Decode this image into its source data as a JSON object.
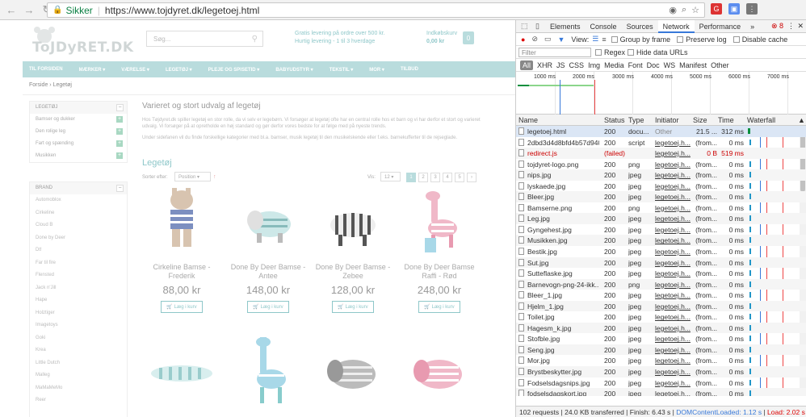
{
  "browser": {
    "secure_label": "Sikker",
    "url": "https://www.tojdyret.dk/legetoej.html"
  },
  "site": {
    "logo_text": "ToJDyRET.DK",
    "search_placeholder": "Søg...",
    "shipping_line1": "Gratis levering på ordre over 500 kr.",
    "shipping_line2": "Hurtig levering - 1 til 3 hverdage",
    "cart_label": "Indkøbskurv",
    "cart_amount": "0,00 kr",
    "cart_count": "0",
    "menu": [
      "TIL FORSIDEN",
      "MÆRKER ▾",
      "VÆRELSE ▾",
      "LEGETØJ ▾",
      "PLEJE OG SPISETID ▾",
      "BABYUDSTYR ▾",
      "TEKSTIL ▾",
      "MOR ▾",
      "TILBUD"
    ],
    "breadcrumb_home": "Forside",
    "breadcrumb_current": "Legetøj",
    "sidebar_legetoej_title": "LEGETØJ",
    "sidebar_legetoej": [
      "Bamser og dukker",
      "Den rolige leg",
      "Fart og spænding",
      "Musikken"
    ],
    "sidebar_brand_title": "BRAND",
    "brands": [
      "Automoblox",
      "Cirkeline",
      "Cloud B",
      "Done by Deer",
      "Dt!",
      "Far til fire",
      "Flensted",
      "Jack n'Jill",
      "Hape",
      "Holztiger",
      "Imagetoys",
      "Goki",
      "Krea",
      "Little Dutch",
      "Malleg",
      "MaMaMeMo",
      "Reer"
    ],
    "main_title": "Varieret og stort udvalg af legetøj",
    "intro1": "Hos Tøjdyret.dk spiller legetøj en stor rolle, da vi selv er legebørn. Vi forsøger at legetøj ofte har en central rolle hos et barn og vi har derfor et stort og varieret udvalg. Vi forsøger på at opretholde en høj standard og gør derfor vores bedste for at følge med på nyeste trends.",
    "intro2": "Under sidefanen vil du finde forskellige kategorier med bl.a. bamser, musik legetøj til den musikelskende eller f.eks. barnekufferter til de rejseglade.",
    "category_title": "Legetøj",
    "sort_label": "Sorter efter:",
    "sort_value": "Position",
    "vis_label": "Vis:",
    "vis_value": "12",
    "pages": [
      "1",
      "2",
      "3",
      "4",
      "5",
      "›"
    ],
    "add_to_cart": "Læg i kurv",
    "products": [
      {
        "name": "Cirkeline Bamse - Frederik",
        "price": "88,00 kr"
      },
      {
        "name": "Done By Deer Bamse - Antee",
        "price": "148,00 kr"
      },
      {
        "name": "Done By Deer Bamse - Zebee",
        "price": "128,00 kr"
      },
      {
        "name": "Done By Deer Bamse Raffi - Rød",
        "price": "248,00 kr"
      }
    ]
  },
  "devtools": {
    "tabs": [
      "Elements",
      "Console",
      "Sources",
      "Network",
      "Performance",
      "»"
    ],
    "error_count": "8",
    "view_label": "View:",
    "group_by_frame": "Group by frame",
    "preserve_log": "Preserve log",
    "disable_cache": "Disable cache",
    "filter_placeholder": "Filter",
    "regex": "Regex",
    "hide_data_urls": "Hide data URLs",
    "types": [
      "All",
      "XHR",
      "JS",
      "CSS",
      "Img",
      "Media",
      "Font",
      "Doc",
      "WS",
      "Manifest",
      "Other"
    ],
    "timeline_ticks": [
      "1000 ms",
      "2000 ms",
      "3000 ms",
      "4000 ms",
      "5000 ms",
      "6000 ms",
      "7000 ms"
    ],
    "columns": {
      "name": "Name",
      "status": "Status",
      "type": "Type",
      "initiator": "Initiator",
      "size": "Size",
      "time": "Time",
      "waterfall": "Waterfall"
    },
    "requests": [
      {
        "name": "legetoej.html",
        "status": "200",
        "type": "docu...",
        "initiator": "Other",
        "size": "21.5 ...",
        "time": "312 ms"
      },
      {
        "name": "2dbd3d4d8bfd4b57d940...",
        "status": "200",
        "type": "script",
        "initiator": "legetoej.h...",
        "size": "(from...",
        "time": "0 ms"
      },
      {
        "name": "redirect.js",
        "status": "(failed)",
        "type": "",
        "initiator": "legetoej.h...",
        "size": "0 B",
        "time": "519 ms"
      },
      {
        "name": "tojdyret-logo.png",
        "status": "200",
        "type": "png",
        "initiator": "legetoej.h...",
        "size": "(from...",
        "time": "0 ms"
      },
      {
        "name": "nips.jpg",
        "status": "200",
        "type": "jpeg",
        "initiator": "legetoej.h...",
        "size": "(from...",
        "time": "0 ms"
      },
      {
        "name": "lyskaede.jpg",
        "status": "200",
        "type": "jpeg",
        "initiator": "legetoej.h...",
        "size": "(from...",
        "time": "0 ms"
      },
      {
        "name": "Bleer.jpg",
        "status": "200",
        "type": "jpeg",
        "initiator": "legetoej.h...",
        "size": "(from...",
        "time": "0 ms"
      },
      {
        "name": "Bamserne.png",
        "status": "200",
        "type": "png",
        "initiator": "legetoej.h...",
        "size": "(from...",
        "time": "0 ms"
      },
      {
        "name": "Leg.jpg",
        "status": "200",
        "type": "jpeg",
        "initiator": "legetoej.h...",
        "size": "(from...",
        "time": "0 ms"
      },
      {
        "name": "Gyngehest.jpg",
        "status": "200",
        "type": "jpeg",
        "initiator": "legetoej.h...",
        "size": "(from...",
        "time": "0 ms"
      },
      {
        "name": "Musikken.jpg",
        "status": "200",
        "type": "jpeg",
        "initiator": "legetoej.h...",
        "size": "(from...",
        "time": "0 ms"
      },
      {
        "name": "Bestik.jpg",
        "status": "200",
        "type": "jpeg",
        "initiator": "legetoej.h...",
        "size": "(from...",
        "time": "0 ms"
      },
      {
        "name": "Sut.jpg",
        "status": "200",
        "type": "jpeg",
        "initiator": "legetoej.h...",
        "size": "(from...",
        "time": "0 ms"
      },
      {
        "name": "Sutteflaske.jpg",
        "status": "200",
        "type": "jpeg",
        "initiator": "legetoej.h...",
        "size": "(from...",
        "time": "0 ms"
      },
      {
        "name": "Barnevogn-png-24-ikk...",
        "status": "200",
        "type": "png",
        "initiator": "legetoej.h...",
        "size": "(from...",
        "time": "0 ms"
      },
      {
        "name": "Bleer_1.jpg",
        "status": "200",
        "type": "jpeg",
        "initiator": "legetoej.h...",
        "size": "(from...",
        "time": "0 ms"
      },
      {
        "name": "Hjelm_1.jpg",
        "status": "200",
        "type": "jpeg",
        "initiator": "legetoej.h...",
        "size": "(from...",
        "time": "0 ms"
      },
      {
        "name": "Toilet.jpg",
        "status": "200",
        "type": "jpeg",
        "initiator": "legetoej.h...",
        "size": "(from...",
        "time": "0 ms"
      },
      {
        "name": "Hagesm_k.jpg",
        "status": "200",
        "type": "jpeg",
        "initiator": "legetoej.h...",
        "size": "(from...",
        "time": "0 ms"
      },
      {
        "name": "Stofble.jpg",
        "status": "200",
        "type": "jpeg",
        "initiator": "legetoej.h...",
        "size": "(from...",
        "time": "0 ms"
      },
      {
        "name": "Seng.jpg",
        "status": "200",
        "type": "jpeg",
        "initiator": "legetoej.h...",
        "size": "(from...",
        "time": "0 ms"
      },
      {
        "name": "Mor.jpg",
        "status": "200",
        "type": "jpeg",
        "initiator": "legetoej.h...",
        "size": "(from...",
        "time": "0 ms"
      },
      {
        "name": "Brystbeskytter.jpg",
        "status": "200",
        "type": "jpeg",
        "initiator": "legetoej.h...",
        "size": "(from...",
        "time": "0 ms"
      },
      {
        "name": "Fodselsdagsnips.jpg",
        "status": "200",
        "type": "jpeg",
        "initiator": "legetoej.h...",
        "size": "(from...",
        "time": "0 ms"
      },
      {
        "name": "fodselsdagskort.jpg",
        "status": "200",
        "type": "jpeg",
        "initiator": "legetoej.h...",
        "size": "(from...",
        "time": "0 ms"
      }
    ],
    "status_requests": "102 requests",
    "status_transferred": "24.0 KB transferred",
    "status_finish": "Finish: 6.43 s",
    "status_dcl": "DOMContentLoaded: 1.12 s",
    "status_load": "Load: 2.02 s"
  }
}
